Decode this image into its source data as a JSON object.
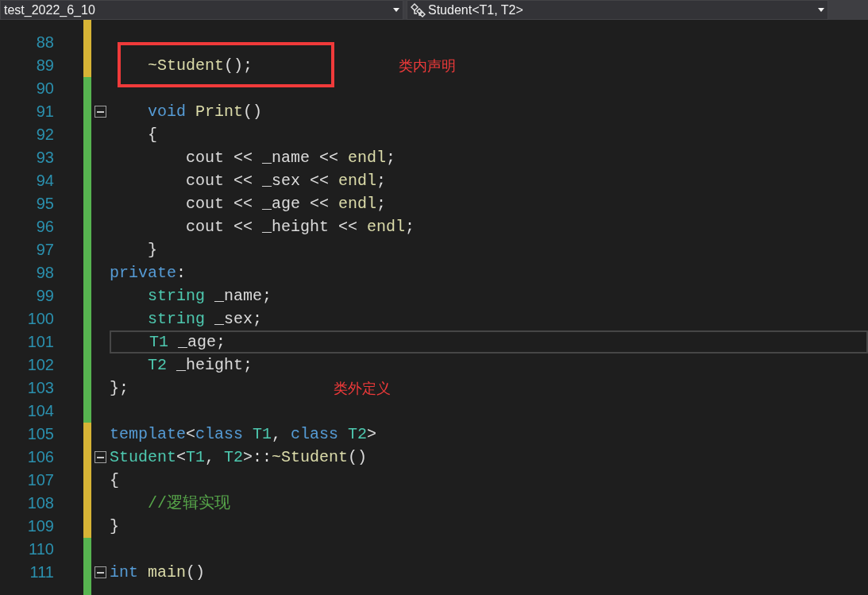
{
  "navigation_bar": {
    "file_dropdown": "test_2022_6_10",
    "scope_dropdown": "Student<T1, T2>"
  },
  "lines": [
    {
      "partial": true,
      "modified": true
    },
    {
      "number": "88",
      "modified": true
    },
    {
      "number": "89",
      "modified": true,
      "tokens": [
        {
          "kind": "function",
          "text": "    ~Student"
        },
        {
          "kind": "plain",
          "text": "();"
        }
      ]
    },
    {
      "number": "90",
      "modified": false
    },
    {
      "number": "91",
      "modified": false,
      "fold": true,
      "tokens": [
        {
          "kind": "keyword",
          "text": "    void"
        },
        {
          "kind": "function",
          "text": " Print"
        },
        {
          "kind": "plain",
          "text": "()"
        }
      ]
    },
    {
      "number": "92",
      "modified": false,
      "tokens": [
        {
          "kind": "plain",
          "text": "    {"
        }
      ]
    },
    {
      "number": "93",
      "modified": false,
      "tokens": [
        {
          "kind": "plain",
          "text": "        cout << _name << "
        },
        {
          "kind": "function",
          "text": "endl"
        },
        {
          "kind": "plain",
          "text": ";"
        }
      ]
    },
    {
      "number": "94",
      "modified": false,
      "tokens": [
        {
          "kind": "plain",
          "text": "        cout << _sex << "
        },
        {
          "kind": "function",
          "text": "endl"
        },
        {
          "kind": "plain",
          "text": ";"
        }
      ]
    },
    {
      "number": "95",
      "modified": false,
      "tokens": [
        {
          "kind": "plain",
          "text": "        cout << _age << "
        },
        {
          "kind": "function",
          "text": "endl"
        },
        {
          "kind": "plain",
          "text": ";"
        }
      ]
    },
    {
      "number": "96",
      "modified": false,
      "tokens": [
        {
          "kind": "plain",
          "text": "        cout << _height << "
        },
        {
          "kind": "function",
          "text": "endl"
        },
        {
          "kind": "plain",
          "text": ";"
        }
      ]
    },
    {
      "number": "97",
      "modified": false,
      "tokens": [
        {
          "kind": "plain",
          "text": "    }"
        }
      ]
    },
    {
      "number": "98",
      "modified": false,
      "tokens": [
        {
          "kind": "keyword",
          "text": "private"
        },
        {
          "kind": "plain",
          "text": ":"
        }
      ]
    },
    {
      "number": "99",
      "modified": false,
      "tokens": [
        {
          "kind": "type",
          "text": "    string"
        },
        {
          "kind": "plain",
          "text": " _name;"
        }
      ]
    },
    {
      "number": "100",
      "modified": false,
      "tokens": [
        {
          "kind": "type",
          "text": "    string"
        },
        {
          "kind": "plain",
          "text": " _sex;"
        }
      ]
    },
    {
      "number": "101",
      "modified": false,
      "current": true,
      "tokens": [
        {
          "kind": "type",
          "text": "    T1"
        },
        {
          "kind": "plain",
          "text": " _age;"
        }
      ]
    },
    {
      "number": "102",
      "modified": false,
      "tokens": [
        {
          "kind": "type",
          "text": "    T2"
        },
        {
          "kind": "plain",
          "text": " _height;"
        }
      ]
    },
    {
      "number": "103",
      "modified": false,
      "tokens": [
        {
          "kind": "plain",
          "text": "};"
        }
      ]
    },
    {
      "number": "104",
      "modified": false
    },
    {
      "number": "105",
      "modified": true,
      "tokens": [
        {
          "kind": "keyword",
          "text": "template"
        },
        {
          "kind": "plain",
          "text": "<"
        },
        {
          "kind": "keyword",
          "text": "class"
        },
        {
          "kind": "type",
          "text": " T1"
        },
        {
          "kind": "plain",
          "text": ", "
        },
        {
          "kind": "keyword",
          "text": "class"
        },
        {
          "kind": "type",
          "text": " T2"
        },
        {
          "kind": "plain",
          "text": ">"
        }
      ]
    },
    {
      "number": "106",
      "modified": true,
      "fold": true,
      "tokens": [
        {
          "kind": "type",
          "text": "Student"
        },
        {
          "kind": "plain",
          "text": "<"
        },
        {
          "kind": "type",
          "text": "T1"
        },
        {
          "kind": "plain",
          "text": ", "
        },
        {
          "kind": "type",
          "text": "T2"
        },
        {
          "kind": "plain",
          "text": ">::"
        },
        {
          "kind": "function",
          "text": "~Student"
        },
        {
          "kind": "plain",
          "text": "()"
        }
      ]
    },
    {
      "number": "107",
      "modified": true,
      "tokens": [
        {
          "kind": "plain",
          "text": "{"
        }
      ]
    },
    {
      "number": "108",
      "modified": true,
      "tokens": [
        {
          "kind": "comment",
          "text": "    //逻辑实现"
        }
      ]
    },
    {
      "number": "109",
      "modified": true,
      "tokens": [
        {
          "kind": "plain",
          "text": "}"
        }
      ]
    },
    {
      "number": "110",
      "modified": false
    },
    {
      "number": "111",
      "modified": false,
      "fold": true,
      "tokens": [
        {
          "kind": "keyword",
          "text": "int"
        },
        {
          "kind": "function",
          "text": " main"
        },
        {
          "kind": "plain",
          "text": "()"
        }
      ]
    },
    {
      "partial": true,
      "modified": false
    }
  ],
  "annotations": [
    {
      "kind": "box"
    },
    {
      "kind": "note",
      "text": "类内声明"
    },
    {
      "kind": "note",
      "text": "类外定义"
    }
  ]
}
